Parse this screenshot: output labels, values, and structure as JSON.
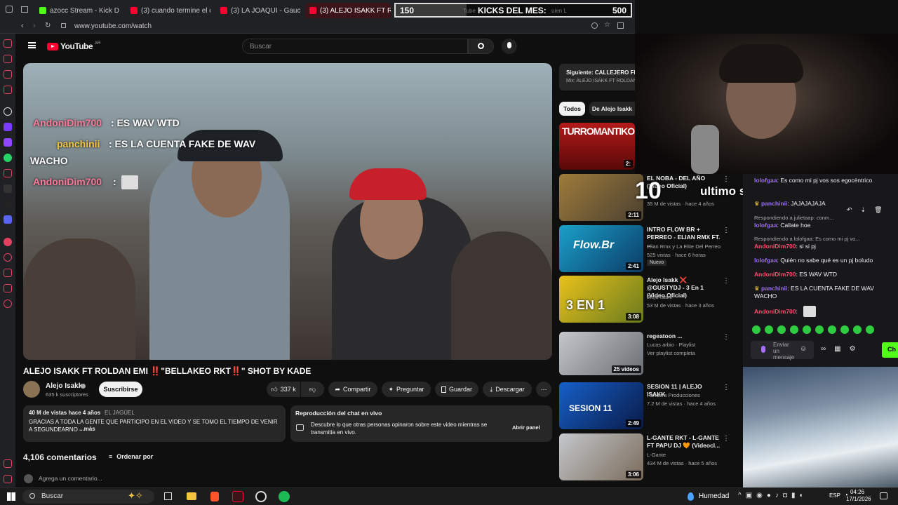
{
  "browser": {
    "tabs": [
      {
        "label": "azocc Stream - Kick Desi",
        "color": "#53fc18"
      },
      {
        "label": "(3) cuando termine el día",
        "color": "#ff0033"
      },
      {
        "label": "(3) LA JOAQUI - Gaucho",
        "color": "#ff0033"
      },
      {
        "label": "(3) ALEJO ISAKK FT ROLD",
        "color": "#ff0033"
      },
      {
        "label": "Tube",
        "color": "#ff0033"
      },
      {
        "label": "uien L",
        "color": "#888888"
      }
    ],
    "url": "www.youtube.com/watch"
  },
  "kick_goal": {
    "current": "150",
    "label": "KICKS DEL MES:",
    "target": "500",
    "progress": 0.3
  },
  "youtube": {
    "logo": "YouTube",
    "region": "AR",
    "search_placeholder": "Buscar",
    "video_overlay_chat": [
      {
        "user": "AndoniDim700",
        "text": ": ES WAV WTD"
      },
      {
        "user": "panchinii",
        "text": ": ES LA CUENTA FAKE DE WAV"
      },
      {
        "user": "",
        "text": "WACHO"
      },
      {
        "user": "AndoniDim700",
        "text": ":"
      }
    ],
    "video_title": "ALEJO ISAKK FT ROLDAN EMI ‼️\"BELLAKEO RKT‼️\" SHOT BY KADE",
    "channel": {
      "name": "Alejo Isakk",
      "subs": "635 k suscriptores",
      "subscribe_label": "Suscribirse"
    },
    "actions": {
      "likes": "337 k",
      "share": "Compartir",
      "ask": "Preguntar",
      "save": "Guardar",
      "download": "Descargar"
    },
    "description": {
      "stats": "40 M de vistas  hace 4 años",
      "location": "EL JAGÜEL",
      "text": "GRACIAS A TODA LA GENTE QUE PARTICIPO EN EL VIDEO Y SE TOMO EL TIEMPO DE VENIR A SEGUNDEARNOS...",
      "more": "...más"
    },
    "live_chat_card": {
      "title": "Reproducción del chat en vivo",
      "text": "Descubre lo que otras personas opinaron sobre este video mientras se transmitía en vivo.",
      "button": "Abrir panel"
    },
    "comments": {
      "count": "4,106 comentarios",
      "sort_label": "Ordenar por",
      "add_placeholder": "Agrega un comentario..."
    },
    "next_up": {
      "label": "Siguiente: CALLEJERO FIN",
      "sub": "Mix: ALEJO ISAKK FT ROLDAN"
    },
    "chips": [
      "Todos",
      "De Alejo Isakk"
    ],
    "recommendations": [
      {
        "title": "",
        "meta1": "",
        "meta2": "",
        "duration": "2:",
        "badge": ""
      },
      {
        "title": "EL NOBA - DEL AÑO (Video Oficial)",
        "meta1": "",
        "meta2": "35 M de vistas · hace 4 años",
        "duration": "2:11",
        "badge": ""
      },
      {
        "title": "INTRO FLOW BR + PERREO - ELIAN RMX FT. ...",
        "meta1": "Elian Rmx y La Elite Del Perreo",
        "meta2": "525 vistas · hace 6 horas",
        "duration": "2:41",
        "badge": "Nuevo"
      },
      {
        "title": "Alejo Isakk ❌ @GUSTYDJ - 3 En 1 (Video Oficial)",
        "meta1": "Alejo Isakk",
        "meta2": "53 M de vistas · hace 3 años",
        "duration": "3:08",
        "badge": ""
      },
      {
        "title": "regeatoon ...",
        "meta1": "Lucas arbio · Playlist",
        "meta2": "Ver playlist completa",
        "duration": "25 videos",
        "badge": ""
      },
      {
        "title": "SESION 11 | ALEJO ISAKK",
        "meta1": "Pandora Producciones",
        "meta2": "7.2 M de vistas · hace 4 años",
        "duration": "2:49",
        "badge": ""
      },
      {
        "title": "L-GANTE RKT - L-GANTE FT PAPU DJ 🧡 (Videocl...",
        "meta1": "L-Gante",
        "meta2": "434 M de vistas · hace 5 años",
        "duration": "3:06",
        "badge": ""
      }
    ]
  },
  "stream_overlay": {
    "follower_count": "10",
    "follower_text": "ultimo seguidor: Itsaar",
    "chat": [
      {
        "user": "lolofgaa",
        "text": ": Es como mi pj vos sos egocéntrico",
        "color": "#9b6cff"
      },
      {
        "user": "panchinii",
        "text": ": JAJAJAJAJA",
        "color": "#9b6cff"
      },
      {
        "user": "",
        "text": "Respondiendo a julietaap: conm...",
        "color": "#aaaaaa"
      },
      {
        "user": "lolofgaa",
        "text": ": Callate hoe",
        "color": "#9b6cff"
      },
      {
        "user": "",
        "text": "Respondiendo a lolofgaa: Es como mi pj vo...",
        "color": "#aaaaaa"
      },
      {
        "user": "AndoniDim700",
        "text": ": si si pj",
        "color": "#ff4a6e"
      },
      {
        "user": "lolofgaa",
        "text": ": Quién no sabe qué es un pj boludo",
        "color": "#9b6cff"
      },
      {
        "user": "AndoniDim700",
        "text": ": ES WAV WTD",
        "color": "#ff4a6e"
      },
      {
        "user": "panchinii",
        "text": ": ES LA CUENTA FAKE DE WAV WACHO",
        "color": "#9b6cff"
      },
      {
        "user": "AndoniDim700",
        "text": ":",
        "color": "#ff4a6e"
      }
    ],
    "send_placeholder": "Enviar un mensaje",
    "send_button": "Ch"
  },
  "taskbar": {
    "search": "Buscar",
    "weather": "Humedad",
    "lang": "ESP",
    "time": "04:26",
    "date": "17/1/2026"
  }
}
